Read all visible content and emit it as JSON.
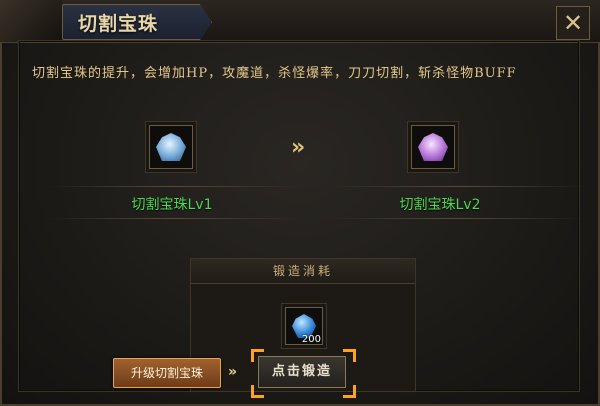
{
  "window": {
    "title": "切割宝珠",
    "close_symbol": "✕"
  },
  "description": "切割宝珠的提升，会增加HP，攻魔道，杀怪爆率，刀刀切割，斩杀怪物BUFF",
  "upgrade": {
    "current": {
      "label": "切割宝珠Lv1",
      "icon": "gem-blue-icon"
    },
    "next": {
      "label": "切割宝珠Lv2",
      "icon": "gem-purple-icon"
    },
    "arrow_symbol": "»"
  },
  "cost": {
    "header": "锻造消耗",
    "item_icon": "blue-diamond-icon",
    "count": "200"
  },
  "buttons": {
    "upgrade_label": "升级切割宝珠",
    "forge_label": "点击锻造",
    "hint_arrow": "»"
  },
  "colors": {
    "title": "#e8d7a8",
    "description": "#e4c88a",
    "item_label": "#4fd94f",
    "highlight": "#ffa21c"
  }
}
